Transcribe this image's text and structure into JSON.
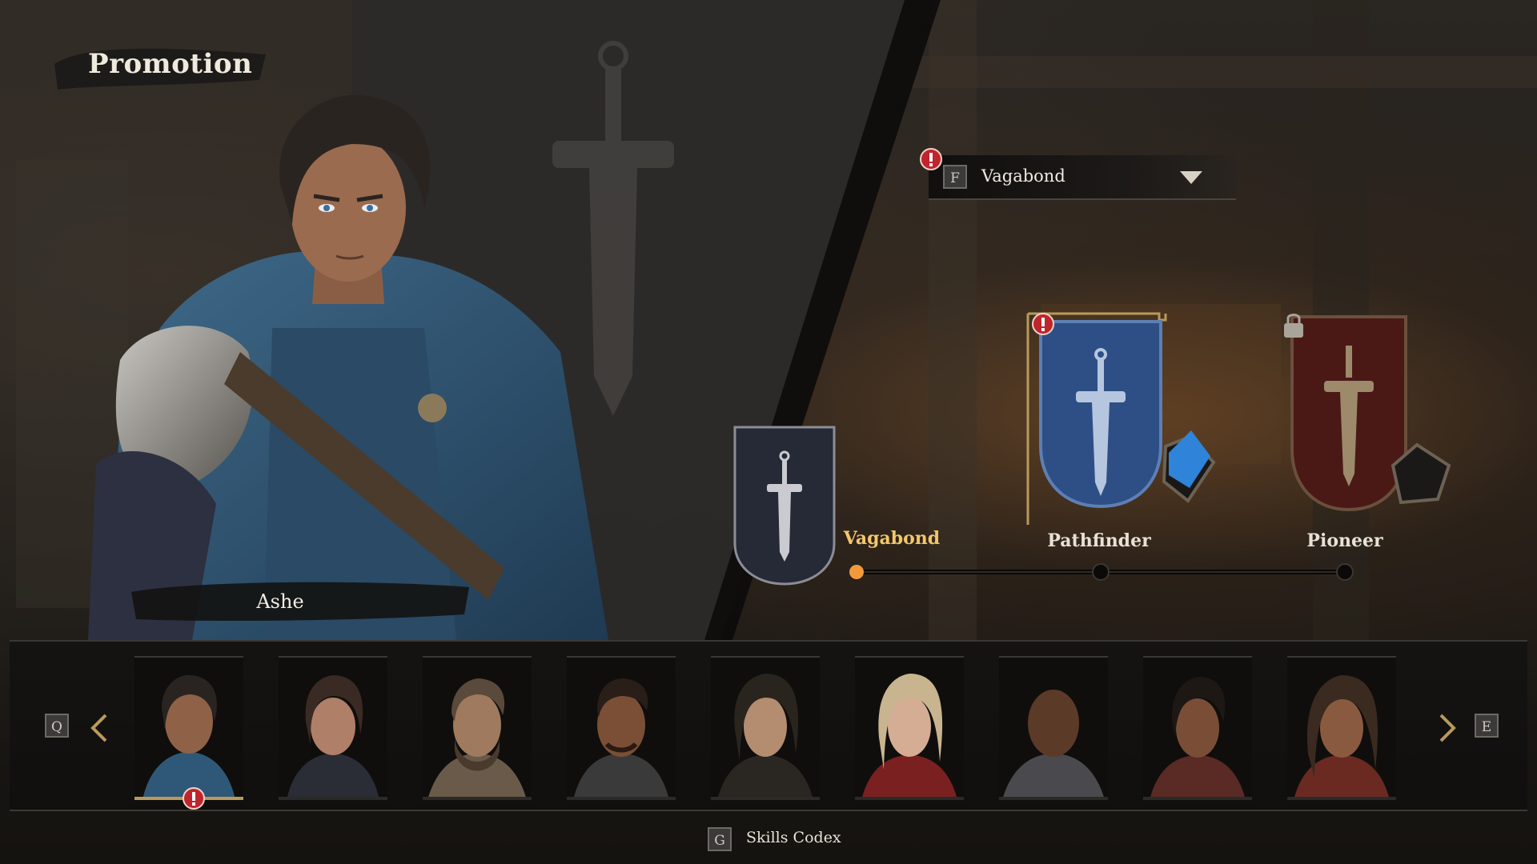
{
  "header": {
    "title": "Promotion"
  },
  "hero": {
    "name": "Ashe"
  },
  "class_select": {
    "key": "F",
    "selected": "Vagabond"
  },
  "progression": {
    "classes": [
      {
        "name": "Vagabond",
        "state": "current",
        "color": "#f2c76a"
      },
      {
        "name": "Pathfinder",
        "state": "available",
        "color": "#e8e2d6"
      },
      {
        "name": "Pioneer",
        "state": "locked",
        "color": "#e8e2d6"
      }
    ]
  },
  "roster": {
    "prev_key": "Q",
    "next_key": "E",
    "characters": [
      {
        "id": "ashe",
        "selected": true,
        "alert": true
      },
      {
        "id": "portrait-2"
      },
      {
        "id": "portrait-3"
      },
      {
        "id": "portrait-4"
      },
      {
        "id": "portrait-5"
      },
      {
        "id": "portrait-6"
      },
      {
        "id": "portrait-7"
      },
      {
        "id": "portrait-8"
      },
      {
        "id": "portrait-9"
      }
    ]
  },
  "footer": {
    "codex_key": "G",
    "codex_label": "Skills Codex"
  },
  "colors": {
    "accent_gold": "#b89a5a",
    "alert_red": "#c0242c",
    "pathfinder_blue": "#3a5e9e",
    "pioneer_red": "#5a1a16"
  }
}
